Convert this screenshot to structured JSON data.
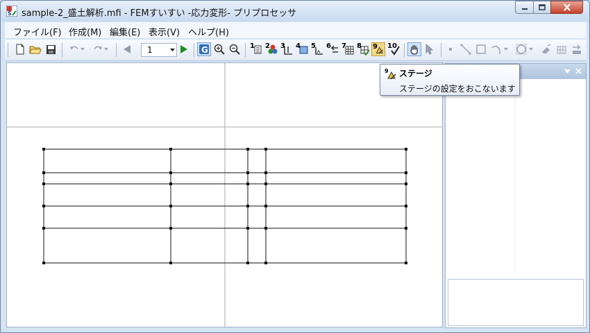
{
  "window": {
    "title": "sample-2_盛土解析.mfi - FEMすいすい -応力変形- プリプロセッサ"
  },
  "menu": {
    "file": "ファイル(F)",
    "create": "作成(M)",
    "edit": "編集(E)",
    "view": "表示(V)",
    "help": "ヘルプ(H)"
  },
  "toolbar": {
    "page_value": "1",
    "stage_numbers": [
      "1",
      "2",
      "3",
      "4",
      "5",
      "6",
      "7",
      "8",
      "9",
      "10"
    ]
  },
  "tooltip": {
    "title": "ステージ",
    "description": "ステージの設定をおこないます"
  },
  "colors": {
    "accent": "#2f6fb7",
    "play_green": "#1e8f1e",
    "close_red": "#c4412b"
  }
}
